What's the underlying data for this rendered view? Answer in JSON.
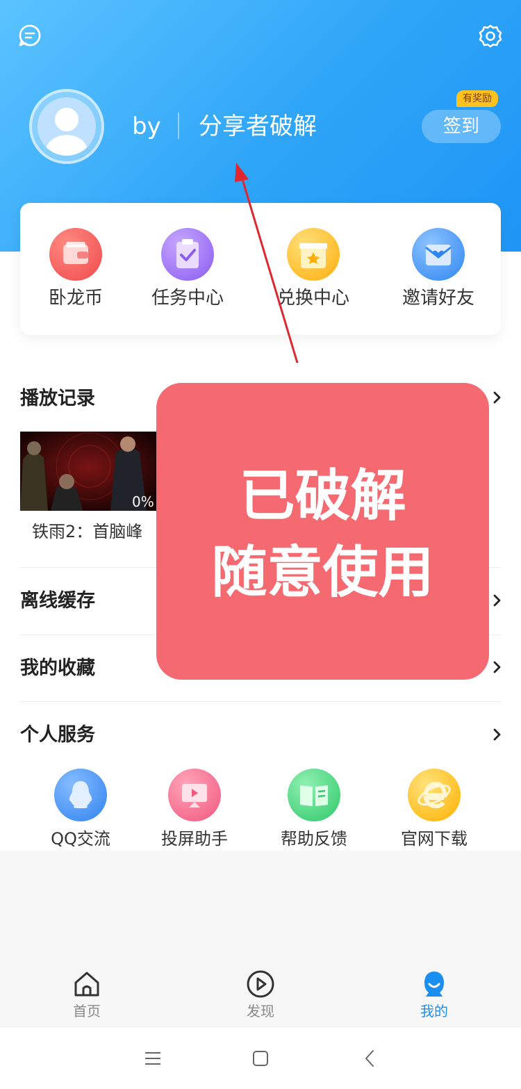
{
  "profile": {
    "prefix": "by",
    "name": "分享者破解",
    "checkin_label": "签到",
    "reward_badge": "有奖励"
  },
  "quick_actions": [
    {
      "label": "卧龙币",
      "icon": "wallet-icon",
      "color": "#f55a5a"
    },
    {
      "label": "任务中心",
      "icon": "task-icon",
      "color": "#9a6cf0"
    },
    {
      "label": "兑换中心",
      "icon": "gift-icon",
      "color": "#ffb515"
    },
    {
      "label": "邀请好友",
      "icon": "invite-icon",
      "color": "#3d93f5"
    }
  ],
  "history": {
    "title": "播放记录",
    "item_title": "铁雨2：首脑峰",
    "progress": "0%"
  },
  "sections": {
    "offline": "离线缓存",
    "favorites": "我的收藏",
    "services": "个人服务"
  },
  "services": [
    {
      "label": "QQ交流",
      "icon": "qq-icon",
      "color": "#3d8ff5"
    },
    {
      "label": "投屏助手",
      "icon": "cast-icon",
      "color": "#f5698c"
    },
    {
      "label": "帮助反馈",
      "icon": "book-icon",
      "color": "#3ed47a"
    },
    {
      "label": "官网下载",
      "icon": "ie-icon",
      "color": "#ffc014"
    }
  ],
  "overlay": {
    "line1": "已破解",
    "line2": "随意使用"
  },
  "tabs": [
    {
      "label": "首页",
      "icon": "home-icon",
      "active": false
    },
    {
      "label": "发现",
      "icon": "play-circle-icon",
      "active": false
    },
    {
      "label": "我的",
      "icon": "profile-mascot-icon",
      "active": true
    }
  ],
  "colors": {
    "accent": "#1a8ff0",
    "hero_start": "#5bc3ff",
    "hero_end": "#1e95f5",
    "overlay": "#f46a70"
  }
}
